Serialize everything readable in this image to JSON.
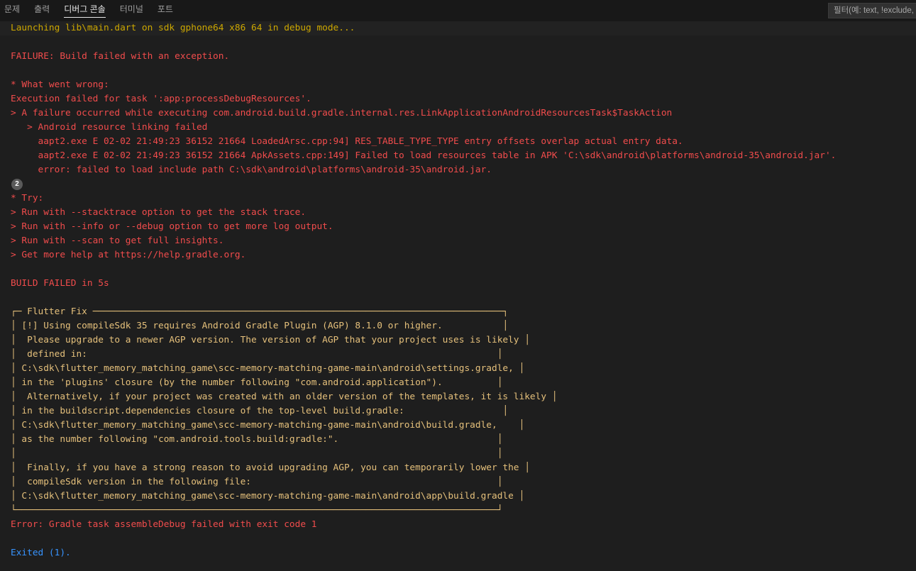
{
  "tabs": [
    {
      "label": "문제",
      "active": false
    },
    {
      "label": "출력",
      "active": false
    },
    {
      "label": "디버그 콘솔",
      "active": true
    },
    {
      "label": "터미널",
      "active": false
    },
    {
      "label": "포트",
      "active": false
    }
  ],
  "filter": {
    "placeholder": "필터(예: text, !exclude, \\escape)",
    "value": ""
  },
  "colors": {
    "launch": "#cca700",
    "error": "#f14c4c",
    "fix": "#e5c07b",
    "exited": "#3794ff",
    "background": "#1e1e1e"
  },
  "badge": {
    "count": "2"
  },
  "lines": [
    {
      "text": "Launching lib\\main.dart on sdk gphone64 x86 64 in debug mode...",
      "kind": "launch"
    },
    {
      "text": "",
      "kind": "blank"
    },
    {
      "text": "FAILURE: Build failed with an exception.",
      "kind": "error"
    },
    {
      "text": "",
      "kind": "blank"
    },
    {
      "text": "* What went wrong:",
      "kind": "error"
    },
    {
      "text": "Execution failed for task ':app:processDebugResources'.",
      "kind": "error"
    },
    {
      "text": "> A failure occurred while executing com.android.build.gradle.internal.res.LinkApplicationAndroidResourcesTask$TaskAction",
      "kind": "error"
    },
    {
      "text": "   > Android resource linking failed",
      "kind": "error"
    },
    {
      "text": "     aapt2.exe E 02-02 21:49:23 36152 21664 LoadedArsc.cpp:94] RES_TABLE_TYPE_TYPE entry offsets overlap actual entry data.",
      "kind": "error"
    },
    {
      "text": "     aapt2.exe E 02-02 21:49:23 36152 21664 ApkAssets.cpp:149] Failed to load resources table in APK 'C:\\sdk\\android\\platforms\\android-35\\android.jar'.",
      "kind": "error"
    },
    {
      "text": "     error: failed to load include path C:\\sdk\\android\\platforms\\android-35\\android.jar.",
      "kind": "error"
    },
    {
      "text": "",
      "kind": "badge"
    },
    {
      "text": "* Try:",
      "kind": "error"
    },
    {
      "text": "> Run with --stacktrace option to get the stack trace.",
      "kind": "error"
    },
    {
      "text": "> Run with --info or --debug option to get more log output.",
      "kind": "error"
    },
    {
      "text": "> Run with --scan to get full insights.",
      "kind": "error"
    },
    {
      "text": "> Get more help at https://help.gradle.org.",
      "kind": "error"
    },
    {
      "text": "",
      "kind": "blank"
    },
    {
      "text": "BUILD FAILED in 5s",
      "kind": "error"
    },
    {
      "text": "",
      "kind": "blank"
    },
    {
      "text": "┌─ Flutter Fix ───────────────────────────────────────────────────────────────────────────┐",
      "kind": "fix"
    },
    {
      "text": "│ [!] Using compileSdk 35 requires Android Gradle Plugin (AGP) 8.1.0 or higher.           │",
      "kind": "fix"
    },
    {
      "text": "│  Please upgrade to a newer AGP version. The version of AGP that your project uses is likely │",
      "kind": "fix"
    },
    {
      "text": "│  defined in:                                                                           │",
      "kind": "fix"
    },
    {
      "text": "│ C:\\sdk\\flutter_memory_matching_game\\scc-memory-matching-game-main\\android\\settings.gradle, │",
      "kind": "fix"
    },
    {
      "text": "│ in the 'plugins' closure (by the number following \"com.android.application\").          │",
      "kind": "fix"
    },
    {
      "text": "│  Alternatively, if your project was created with an older version of the templates, it is likely │",
      "kind": "fix"
    },
    {
      "text": "│ in the buildscript.dependencies closure of the top-level build.gradle:                  │",
      "kind": "fix"
    },
    {
      "text": "│ C:\\sdk\\flutter_memory_matching_game\\scc-memory-matching-game-main\\android\\build.gradle,    │",
      "kind": "fix"
    },
    {
      "text": "│ as the number following \"com.android.tools.build:gradle:\".                             │",
      "kind": "fix"
    },
    {
      "text": "│                                                                                        │",
      "kind": "fix"
    },
    {
      "text": "│  Finally, if you have a strong reason to avoid upgrading AGP, you can temporarily lower the │",
      "kind": "fix"
    },
    {
      "text": "│  compileSdk version in the following file:                                             │",
      "kind": "fix"
    },
    {
      "text": "│ C:\\sdk\\flutter_memory_matching_game\\scc-memory-matching-game-main\\android\\app\\build.gradle │",
      "kind": "fix"
    },
    {
      "text": "└────────────────────────────────────────────────────────────────────────────────────────┘",
      "kind": "fix"
    },
    {
      "text": "Error: Gradle task assembleDebug failed with exit code 1",
      "kind": "error"
    },
    {
      "text": "",
      "kind": "blank"
    },
    {
      "text": "Exited (1).",
      "kind": "exited"
    }
  ]
}
